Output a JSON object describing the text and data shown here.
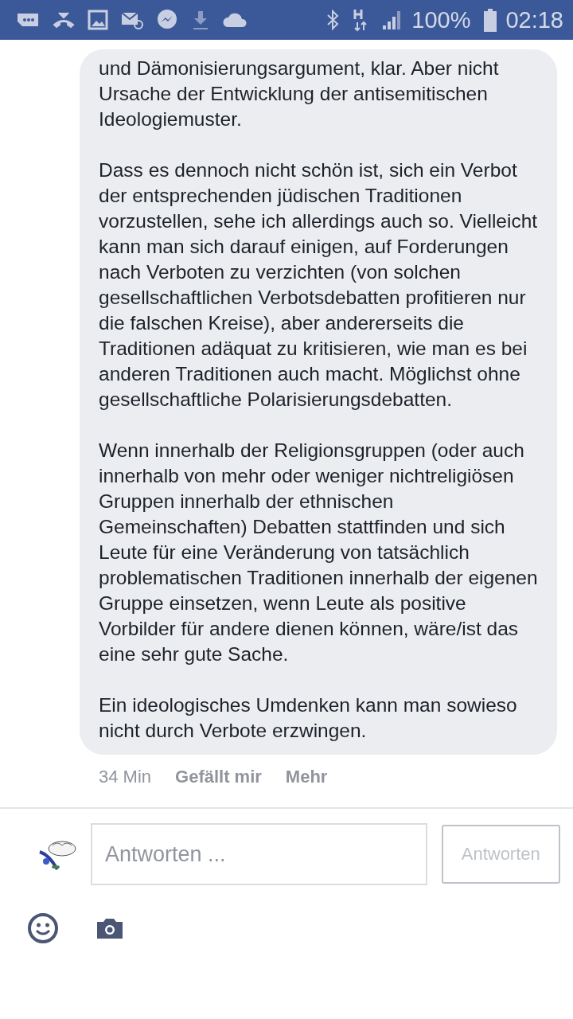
{
  "status_bar": {
    "battery": "100%",
    "time": "02:18"
  },
  "comment": {
    "paragraphs": [
      "und Dämonisierungsargument, klar. Aber nicht Ursache der Entwicklung der antisemitischen Ideologiemuster.",
      "Dass es dennoch nicht schön ist, sich ein Verbot der entsprechenden jüdischen Traditionen vorzustellen, sehe ich allerdings auch so. Vielleicht kann man sich darauf einigen, auf Forderungen nach Verboten zu verzichten (von solchen gesellschaftlichen Verbotsdebatten profitieren nur die falschen Kreise), aber andererseits die Traditionen adäquat zu kritisieren, wie man es bei anderen Traditionen auch macht. Möglichst ohne gesellschaftliche Polarisierungsdebatten.",
      "Wenn innerhalb der Religionsgruppen (oder auch innerhalb von mehr oder weniger nichtreligiösen Gruppen innerhalb der ethnischen Gemeinschaften) Debatten stattfinden und sich Leute für eine Veränderung von tatsächlich problematischen Traditionen innerhalb der eigenen Gruppe einsetzen, wenn Leute als positive Vorbilder für andere dienen können, wäre/ist das eine sehr gute Sache.",
      "Ein ideologisches Umdenken kann man sowieso nicht durch Verbote erzwingen."
    ],
    "time": "34 Min",
    "like": "Gefällt mir",
    "more": "Mehr"
  },
  "reply": {
    "placeholder": "Antworten ...",
    "button": "Antworten"
  }
}
